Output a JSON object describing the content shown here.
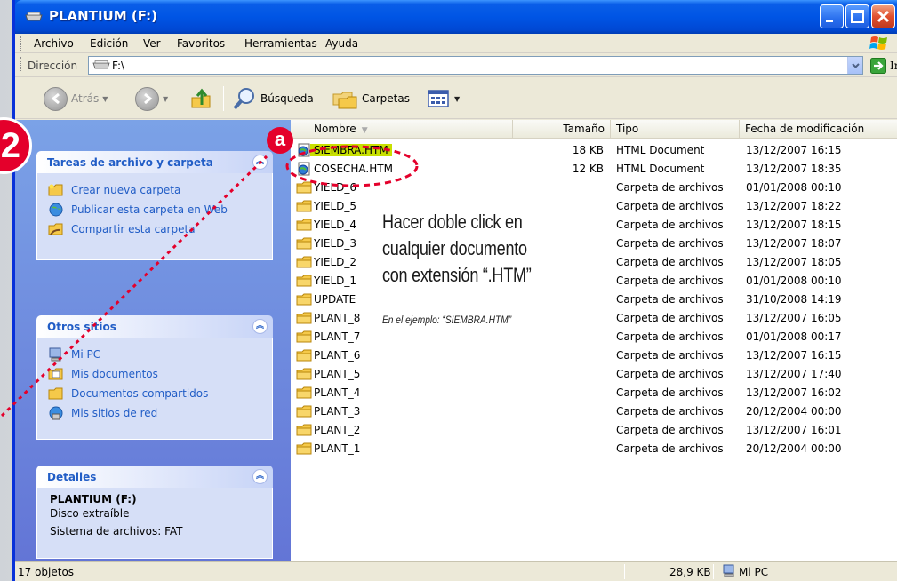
{
  "window": {
    "title": "PLANTIUM (F:)"
  },
  "menu": [
    "Archivo",
    "Edición",
    "Ver",
    "Favoritos",
    "Herramientas",
    "Ayuda"
  ],
  "address": {
    "label": "Dirección",
    "value": "F:\\",
    "go_label": "Ir"
  },
  "toolbar": {
    "back": "Atrás",
    "search": "Búsqueda",
    "folders": "Carpetas"
  },
  "tasks_panel": {
    "title": "Tareas de archivo y carpeta",
    "items": [
      {
        "label": "Crear nueva carpeta",
        "icon": "new-folder-icon"
      },
      {
        "label": "Publicar esta carpeta en Web",
        "icon": "web-publish-icon"
      },
      {
        "label": "Compartir esta carpeta",
        "icon": "share-folder-icon"
      }
    ]
  },
  "places_panel": {
    "title": "Otros sitios",
    "items": [
      {
        "label": "Mi PC",
        "icon": "my-computer-icon"
      },
      {
        "label": "Mis documentos",
        "icon": "my-documents-icon"
      },
      {
        "label": "Documentos compartidos",
        "icon": "shared-documents-icon"
      },
      {
        "label": "Mis sitios de red",
        "icon": "network-places-icon"
      }
    ]
  },
  "details_panel": {
    "title": "Detalles",
    "name": "PLANTIUM (F:)",
    "kind": "Disco extraíble",
    "filesystem": "Sistema de archivos: FAT"
  },
  "columns": {
    "name": "Nombre",
    "size": "Tamaño",
    "type": "Tipo",
    "date": "Fecha de modificación"
  },
  "files": [
    {
      "name": "SIEMBRA.HTM",
      "size": "18 KB",
      "type": "HTML Document",
      "date": "13/12/2007 16:15",
      "icon": "html-document-icon",
      "selected": true
    },
    {
      "name": "COSECHA.HTM",
      "size": "12 KB",
      "type": "HTML Document",
      "date": "13/12/2007 18:35",
      "icon": "html-document-icon"
    },
    {
      "name": "YIELD_6",
      "size": "",
      "type": "Carpeta de archivos",
      "date": "01/01/2008 00:10",
      "icon": "folder-icon"
    },
    {
      "name": "YIELD_5",
      "size": "",
      "type": "Carpeta de archivos",
      "date": "13/12/2007 18:22",
      "icon": "folder-icon"
    },
    {
      "name": "YIELD_4",
      "size": "",
      "type": "Carpeta de archivos",
      "date": "13/12/2007 18:15",
      "icon": "folder-icon"
    },
    {
      "name": "YIELD_3",
      "size": "",
      "type": "Carpeta de archivos",
      "date": "13/12/2007 18:07",
      "icon": "folder-icon"
    },
    {
      "name": "YIELD_2",
      "size": "",
      "type": "Carpeta de archivos",
      "date": "13/12/2007 18:05",
      "icon": "folder-icon"
    },
    {
      "name": "YIELD_1",
      "size": "",
      "type": "Carpeta de archivos",
      "date": "01/01/2008 00:10",
      "icon": "folder-icon"
    },
    {
      "name": "UPDATE",
      "size": "",
      "type": "Carpeta de archivos",
      "date": "31/10/2008 14:19",
      "icon": "folder-icon"
    },
    {
      "name": "PLANT_8",
      "size": "",
      "type": "Carpeta de archivos",
      "date": "13/12/2007 16:05",
      "icon": "folder-icon"
    },
    {
      "name": "PLANT_7",
      "size": "",
      "type": "Carpeta de archivos",
      "date": "01/01/2008 00:17",
      "icon": "folder-icon"
    },
    {
      "name": "PLANT_6",
      "size": "",
      "type": "Carpeta de archivos",
      "date": "13/12/2007 16:15",
      "icon": "folder-icon"
    },
    {
      "name": "PLANT_5",
      "size": "",
      "type": "Carpeta de archivos",
      "date": "13/12/2007 17:40",
      "icon": "folder-icon"
    },
    {
      "name": "PLANT_4",
      "size": "",
      "type": "Carpeta de archivos",
      "date": "13/12/2007 16:02",
      "icon": "folder-icon"
    },
    {
      "name": "PLANT_3",
      "size": "",
      "type": "Carpeta de archivos",
      "date": "20/12/2004 00:00",
      "icon": "folder-icon"
    },
    {
      "name": "PLANT_2",
      "size": "",
      "type": "Carpeta de archivos",
      "date": "13/12/2007 16:01",
      "icon": "folder-icon"
    },
    {
      "name": "PLANT_1",
      "size": "",
      "type": "Carpeta de archivos",
      "date": "20/12/2004 00:00",
      "icon": "folder-icon"
    }
  ],
  "annotation": {
    "badge_step": "2",
    "badge_sub": "a",
    "line1": "Hacer doble click en",
    "line2": "cualquier documento",
    "line3": "con extensión “.HTM”",
    "example": "En el ejemplo: “SIEMBRA.HTM”",
    "accent_color": "#e4002b",
    "highlight_color": "#c8e000"
  },
  "status": {
    "count": "17 objetos",
    "size": "28,9 KB",
    "location": "Mi PC"
  }
}
